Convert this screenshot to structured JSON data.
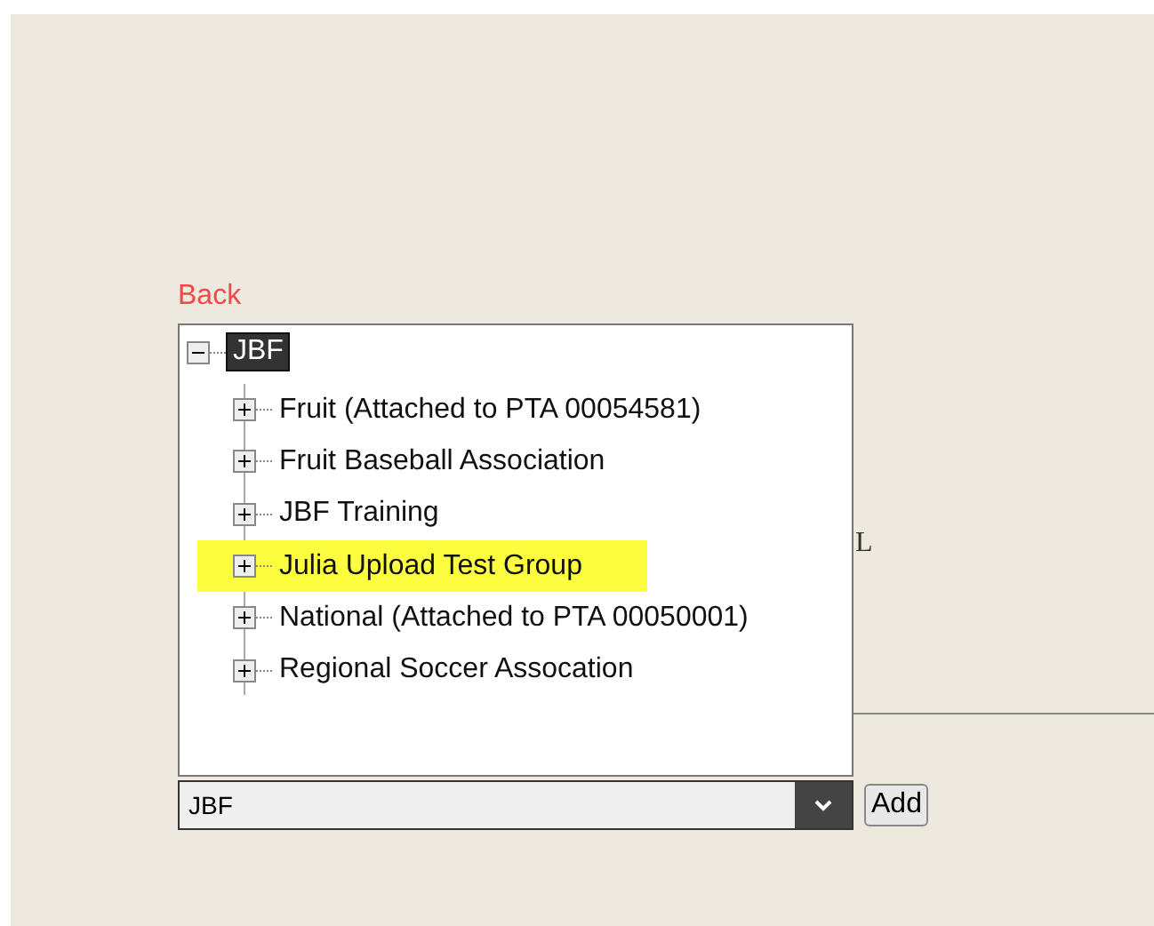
{
  "back_link": "Back",
  "tree": {
    "label": "JBF",
    "expanded": true,
    "selected": true,
    "children": [
      {
        "label": "Fruit (Attached to PTA 00054581)",
        "expanded": false,
        "highlighted": false
      },
      {
        "label": "Fruit Baseball Association",
        "expanded": false,
        "highlighted": false
      },
      {
        "label": "JBF Training",
        "expanded": false,
        "highlighted": false
      },
      {
        "label": "Julia Upload Test Group",
        "expanded": false,
        "highlighted": true
      },
      {
        "label": "National (Attached to PTA 00050001)",
        "expanded": false,
        "highlighted": false
      },
      {
        "label": "Regional Soccer Assocation",
        "expanded": false,
        "highlighted": false
      }
    ]
  },
  "side_text": "L",
  "dropdown": {
    "value": "JBF"
  },
  "add_button": "Add"
}
